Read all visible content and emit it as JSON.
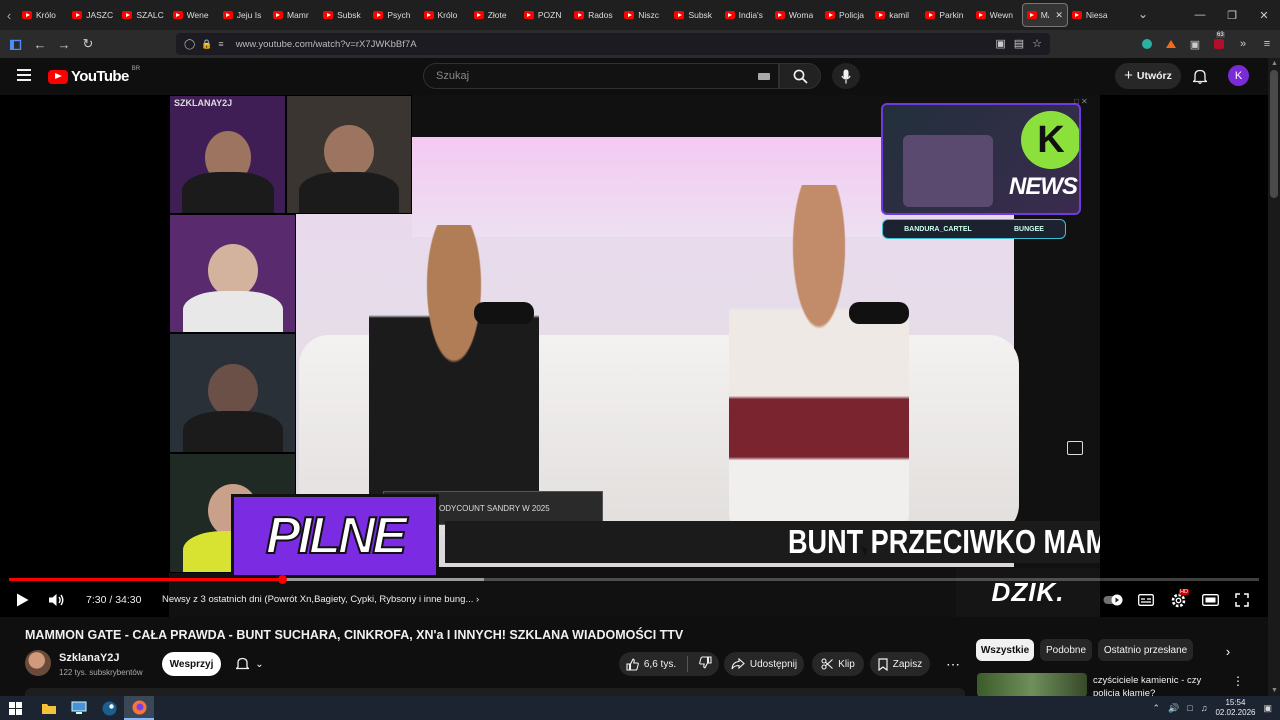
{
  "browser": {
    "tabs": [
      {
        "label": "Królo"
      },
      {
        "label": "JASZC"
      },
      {
        "label": "SZALC"
      },
      {
        "label": "Wene"
      },
      {
        "label": "Jeju Is"
      },
      {
        "label": "Mamr"
      },
      {
        "label": "Subsk"
      },
      {
        "label": "Psych"
      },
      {
        "label": "Królo"
      },
      {
        "label": "Złote"
      },
      {
        "label": "POZN"
      },
      {
        "label": "Rados"
      },
      {
        "label": "Niszc"
      },
      {
        "label": "Subsk"
      },
      {
        "label": "India's"
      },
      {
        "label": "Woma"
      },
      {
        "label": "Policja"
      },
      {
        "label": "kamil"
      },
      {
        "label": "Parkin"
      },
      {
        "label": "Wewn"
      },
      {
        "label": "MA",
        "active": true
      },
      {
        "label": "Niesa"
      }
    ],
    "url": "www.youtube.com/watch?v=rX7JWKbBf7A",
    "extension_badge": "63"
  },
  "youtube": {
    "logo_text": "YouTube",
    "country_code": "BR",
    "search_placeholder": "Szukaj",
    "create_label": "Utwórz",
    "avatar_letter": "K"
  },
  "video": {
    "overlay": {
      "cam_label": "SZKLANAY2J",
      "social_left": "BANDURA_CARTEL",
      "social_right": "BUNGEE",
      "ticker": "ODYCOUNT SANDRY W 2025",
      "headline": "BUNT PRZECIWKO MAM",
      "pilne": "PILNE",
      "dzik": "DZIK.",
      "news": "NEWS",
      "k_badge": "K"
    },
    "time_current": "7:30",
    "time_total": "34:30",
    "time_display": "7:30 / 34:30",
    "chapter": "Newsy z 3 ostatnich dni (Powrót Xn,Bagiety, Cypki, Rybsony i inne bung...",
    "progress_played": 0.218,
    "progress_buffered": 0.38
  },
  "meta": {
    "title": "MAMMON GATE - CAŁA PRAWDA - BUNT SUCHARA, CINKROFA, XN'a I INNYCH! SZKLANA WIADOMOŚCI TTV",
    "channel_name": "SzklanaY2J",
    "subscribers": "122 tys. subskrybentów",
    "support_label": "Wesprzyj",
    "likes": "6,6 tys.",
    "share_label": "Udostępnij",
    "clip_label": "Klip",
    "save_label": "Zapisz"
  },
  "sidebar": {
    "chips": [
      "Wszystkie",
      "Podobne",
      "Ostatnio przesłane"
    ],
    "rec_title": "czyściciele kamienic - czy policja kłamie?"
  },
  "taskbar": {
    "time": "15:54",
    "date": "02.02.2026"
  }
}
